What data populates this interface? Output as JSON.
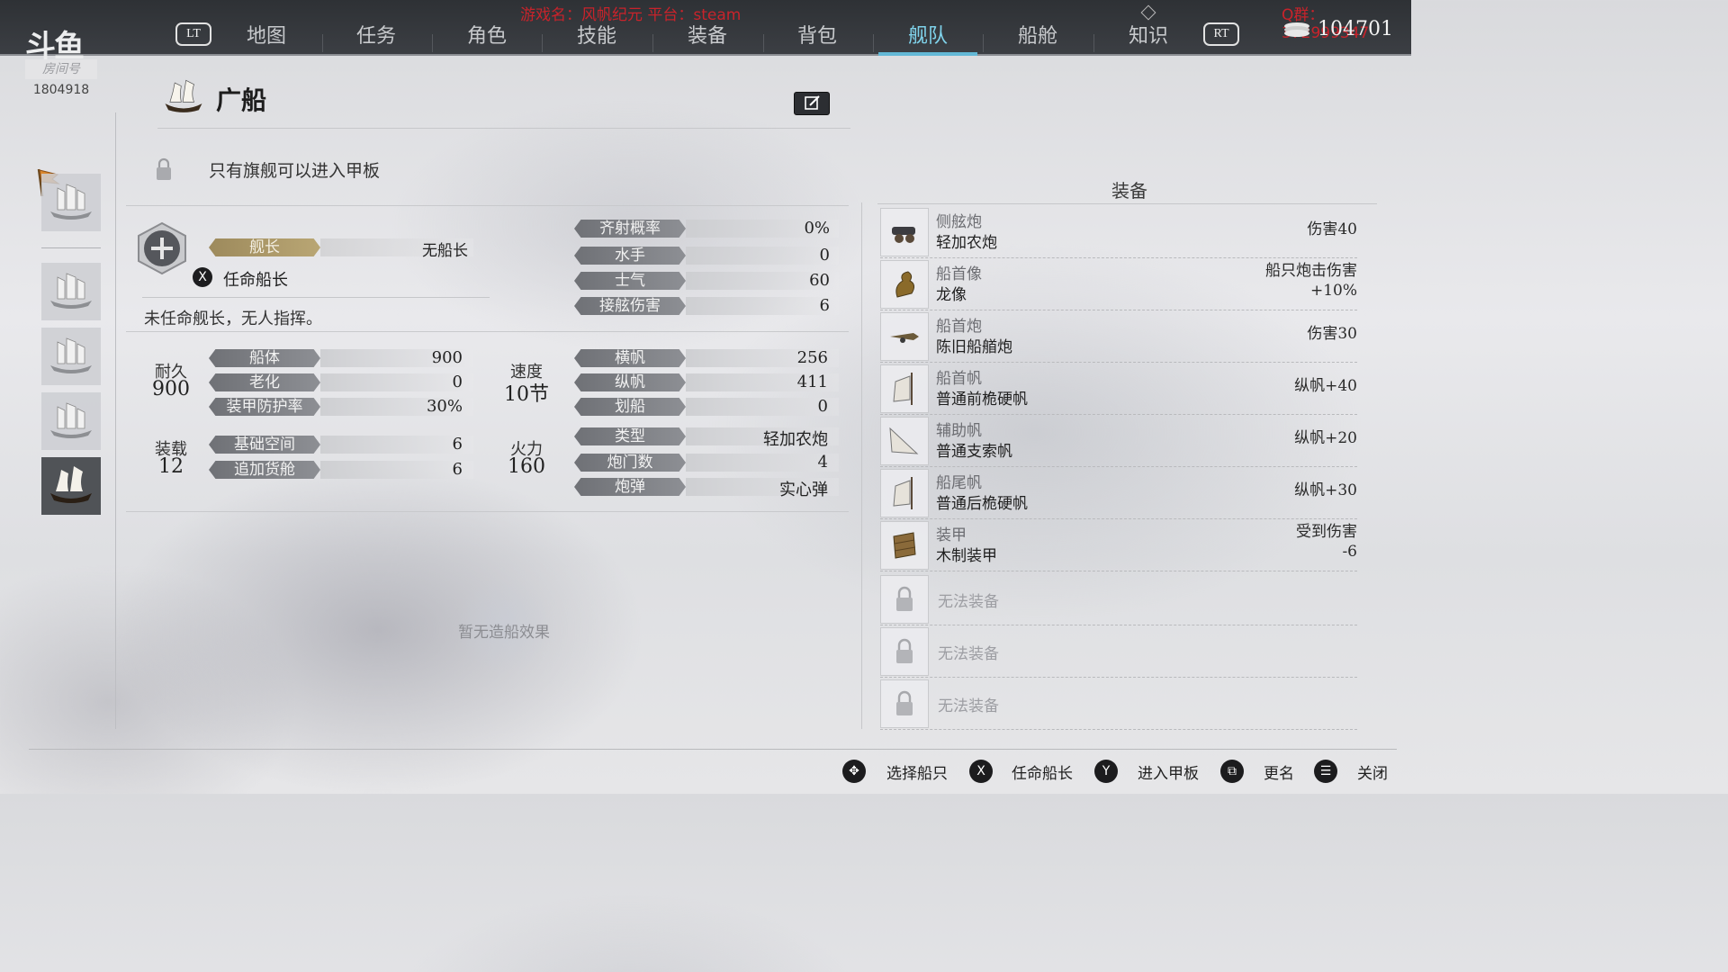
{
  "header": {
    "logo_text": "斗鱼",
    "room_label": "房间号",
    "room_number": "1804918",
    "lt_label": "LT",
    "rt_label": "RT",
    "stream_overlay": "游戏名：风帆纪元 平台：steam",
    "qq_overlay": "Q群：372999347",
    "gold": "104701",
    "tabs": [
      {
        "label": "地图",
        "active": false
      },
      {
        "label": "任务",
        "active": false
      },
      {
        "label": "角色",
        "active": false
      },
      {
        "label": "技能",
        "active": false
      },
      {
        "label": "装备",
        "active": false
      },
      {
        "label": "背包",
        "active": false
      },
      {
        "label": "舰队",
        "active": true
      },
      {
        "label": "船舱",
        "active": false
      },
      {
        "label": "知识",
        "active": false
      }
    ]
  },
  "ship": {
    "name": "广船",
    "flagship_note": "只有旗舰可以进入甲板",
    "captain": {
      "label": "舰长",
      "value": "无船长",
      "appoint_button": "X",
      "appoint_label": "任命船长",
      "note": "未任命舰长，无人指挥。"
    },
    "combat": [
      {
        "label": "齐射概率",
        "value": "0%"
      },
      {
        "label": "水手",
        "value": "0"
      },
      {
        "label": "士气",
        "value": "60"
      },
      {
        "label": "接舷伤害",
        "value": "6"
      }
    ],
    "durability": {
      "title": "耐久",
      "value": "900",
      "rows": [
        {
          "label": "船体",
          "value": "900"
        },
        {
          "label": "老化",
          "value": "0"
        },
        {
          "label": "装甲防护率",
          "value": "30%"
        }
      ]
    },
    "cargo": {
      "title": "装载",
      "value": "12",
      "rows": [
        {
          "label": "基础空间",
          "value": "6"
        },
        {
          "label": "追加货舱",
          "value": "6"
        }
      ]
    },
    "speed": {
      "title": "速度",
      "value": "10节",
      "rows": [
        {
          "label": "横帆",
          "value": "256"
        },
        {
          "label": "纵帆",
          "value": "411"
        },
        {
          "label": "划船",
          "value": "0"
        }
      ]
    },
    "firepower": {
      "title": "火力",
      "value": "160",
      "rows": [
        {
          "label": "类型",
          "value": "轻加农炮"
        },
        {
          "label": "炮门数",
          "value": "4"
        },
        {
          "label": "炮弹",
          "value": "实心弹"
        }
      ]
    },
    "shipbuilding_effect": "暂无造船效果"
  },
  "equipment": {
    "title": "装备",
    "items": [
      {
        "slot": "侧舷炮",
        "name": "轻加农炮",
        "effect": "伤害40",
        "icon": "cannon-icon"
      },
      {
        "slot": "船首像",
        "name": "龙像",
        "effect": "船只炮击伤害",
        "effect2": "+10%",
        "icon": "dragon-figurehead-icon"
      },
      {
        "slot": "船首炮",
        "name": "陈旧船艏炮",
        "effect": "伤害30",
        "icon": "bow-cannon-icon"
      },
      {
        "slot": "船首帆",
        "name": "普通前桅硬帆",
        "effect": "纵帆+40",
        "icon": "foresail-icon"
      },
      {
        "slot": "辅助帆",
        "name": "普通支索帆",
        "effect": "纵帆+20",
        "icon": "staysail-icon"
      },
      {
        "slot": "船尾帆",
        "name": "普通后桅硬帆",
        "effect": "纵帆+30",
        "icon": "mizzen-sail-icon"
      },
      {
        "slot": "装甲",
        "name": "木制装甲",
        "effect": "受到伤害",
        "effect2": "-6",
        "icon": "armor-icon"
      }
    ],
    "locked_label": "无法装备"
  },
  "hints": [
    {
      "key": "✥",
      "label": "选择船只"
    },
    {
      "key": "X",
      "label": "任命船长"
    },
    {
      "key": "Y",
      "label": "进入甲板"
    },
    {
      "key": "⧉",
      "label": "更名"
    },
    {
      "key": "☰",
      "label": "关闭"
    }
  ],
  "colors": {
    "topbar": "#2e3135",
    "active_tab": "#7fd2ea",
    "captain_bar": "#a8956a",
    "stat_bar": "#7b7d82",
    "overlay_red": "#c8232b"
  }
}
